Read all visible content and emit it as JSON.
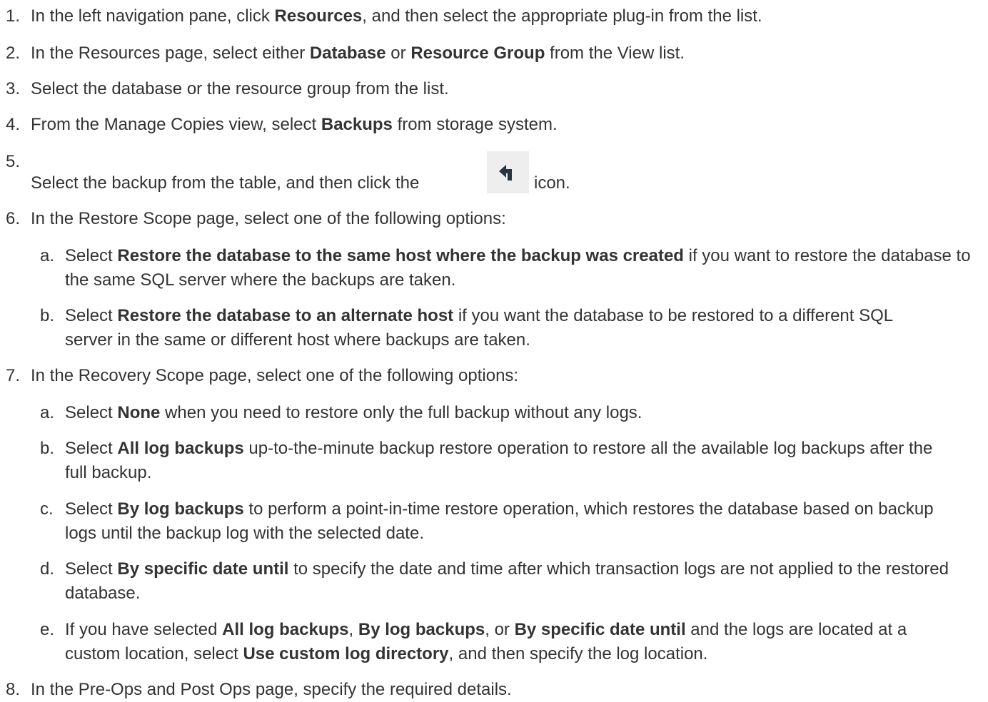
{
  "steps": [
    {
      "num": "1.",
      "parts": [
        "In the left navigation pane, click ",
        "Resources",
        ", and then select the appropriate plug-in from the list."
      ]
    },
    {
      "num": "2.",
      "parts": [
        "In the Resources page, select either ",
        "Database",
        " or ",
        "Resource Group",
        " from the View list."
      ]
    },
    {
      "num": "3.",
      "parts": [
        "Select the database or the resource group from the list."
      ]
    },
    {
      "num": "4.",
      "parts": [
        "From the Manage Copies view, select ",
        "Backups",
        " from storage system."
      ]
    },
    {
      "num": "5.",
      "parts": [
        "Select the backup from the table, and then click the ",
        "icon."
      ],
      "icon": "restore-arrow-icon"
    },
    {
      "num": "6.",
      "parts": [
        "In the Restore Scope page, select one of the following options:"
      ],
      "subs": [
        {
          "letter": "a.",
          "parts": [
            "Select ",
            "Restore the database to the same host where the backup was created",
            " if you want to restore the database to the same SQL server where the backups are taken."
          ]
        },
        {
          "letter": "b.",
          "parts": [
            "Select ",
            "Restore the database to an alternate host",
            " if you want the database to be restored to a different SQL server in the same or different host where backups are taken."
          ]
        }
      ]
    },
    {
      "num": "7.",
      "parts": [
        "In the Recovery Scope page, select one of the following options:"
      ],
      "subs": [
        {
          "letter": "a.",
          "parts": [
            "Select ",
            "None",
            " when you need to restore only the full backup without any logs."
          ]
        },
        {
          "letter": "b.",
          "parts": [
            "Select ",
            "All log backups",
            " up-to-the-minute backup restore operation to restore all the available log backups after the full backup."
          ]
        },
        {
          "letter": "c.",
          "parts": [
            "Select ",
            "By log backups",
            " to perform a point-in-time restore operation, which restores the database based on backup logs until the backup log with the selected date."
          ]
        },
        {
          "letter": "d.",
          "parts": [
            "Select ",
            "By specific date until",
            " to specify the date and time after which transaction logs are not applied to the restored database."
          ]
        },
        {
          "letter": "e.",
          "parts": [
            "If you have selected ",
            "All log backups",
            ", ",
            "By log backups",
            ", or ",
            "By specific date until",
            " and the logs are located at a custom location, select ",
            "Use custom log directory",
            ", and then specify the log location."
          ]
        }
      ]
    },
    {
      "num": "8.",
      "parts": [
        "In the Pre-Ops and Post Ops page, specify the required details."
      ]
    }
  ]
}
